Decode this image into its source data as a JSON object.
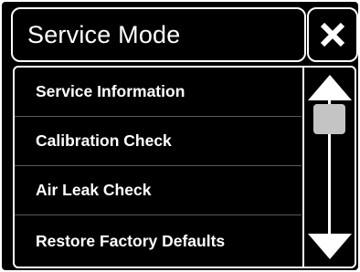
{
  "header": {
    "title": "Service Mode",
    "close_icon": "close-icon"
  },
  "menu": {
    "items": [
      {
        "label": "Service Information"
      },
      {
        "label": "Calibration Check"
      },
      {
        "label": "Air Leak Check"
      },
      {
        "label": "Restore Factory Defaults"
      }
    ]
  },
  "scrollbar": {
    "up_icon": "triangle-up-icon",
    "down_icon": "triangle-down-icon",
    "thumb_color": "#c4c4c4"
  },
  "colors": {
    "background": "#000000",
    "foreground": "#ffffff",
    "divider": "#5a5a5a"
  }
}
